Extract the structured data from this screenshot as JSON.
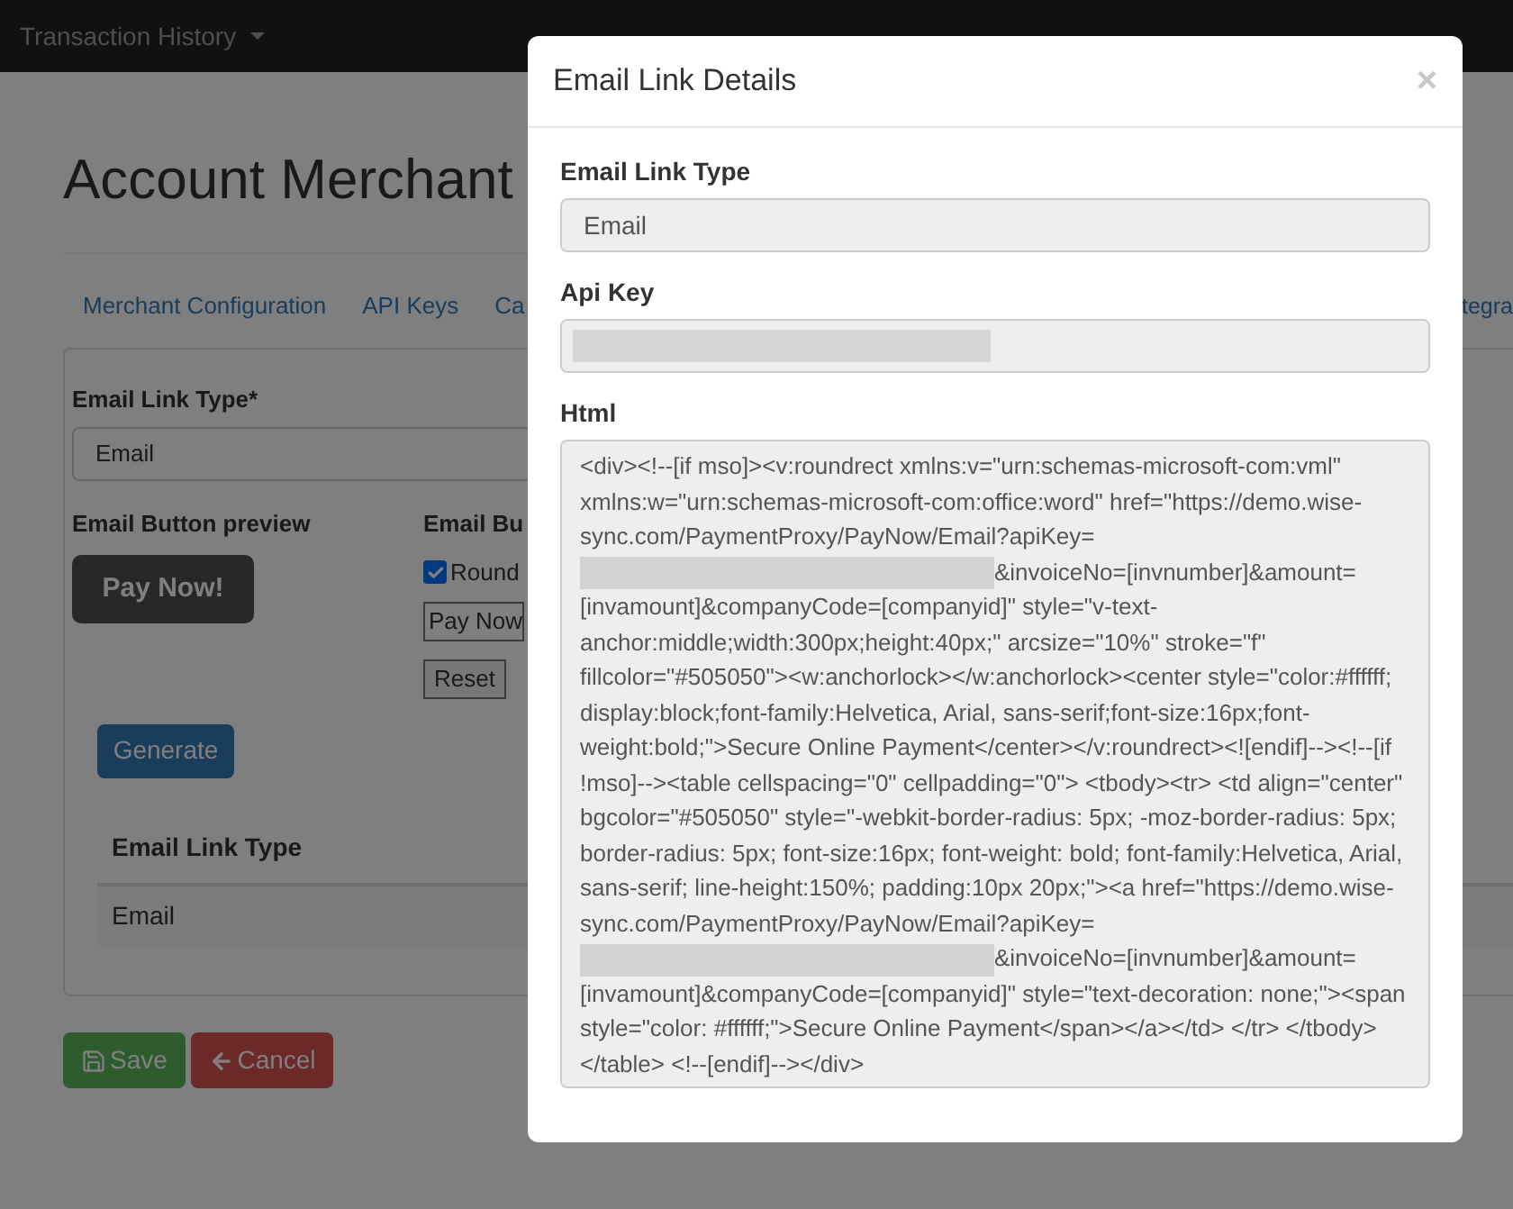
{
  "navbar": {
    "menu": "Transaction History"
  },
  "page": {
    "title": "Account Merchant",
    "tabs": [
      {
        "label": "Merchant Configuration"
      },
      {
        "label": "API Keys"
      },
      {
        "label": "Ca"
      },
      {
        "label": "tegra"
      }
    ],
    "form": {
      "email_link_type": {
        "label": "Email Link Type*",
        "value": "Email"
      },
      "preview": {
        "label": "Email Button preview",
        "button": "Pay Now!"
      },
      "options": {
        "label": "Email Bu",
        "checkbox": {
          "label": "Round",
          "checked": true
        },
        "text_value": "Pay Now",
        "reset": "Reset"
      },
      "generate": "Generate",
      "table": {
        "columns": [
          "Email Link Type"
        ],
        "rows": [
          [
            "Email"
          ]
        ]
      }
    },
    "actions": {
      "save": "Save",
      "cancel": "Cancel"
    }
  },
  "modal": {
    "title": "Email Link Details",
    "close": "×",
    "email_link_type": {
      "label": "Email Link Type",
      "value": "Email"
    },
    "api_key": {
      "label": "Api Key",
      "redacted": true
    },
    "html": {
      "label": "Html",
      "segments": [
        {
          "kind": "text",
          "text": "<div><!--[if mso]><v:roundrect xmlns:v=\"urn:schemas-microsoft-com:vml\" xmlns:w=\"urn:schemas-microsoft-com:office:word\" href=\"https://demo.wise-sync.com/PaymentProxy/PayNow/Email?apiKey="
        },
        {
          "kind": "redacted"
        },
        {
          "kind": "text",
          "text": "&invoiceNo=[invnumber]&amount=[invamount]&companyCode=[companyid]\" style=\"v-text-anchor:middle;width:300px;height:40px;\" arcsize=\"10%\" stroke=\"f\" fillcolor=\"#505050\"><w:anchorlock></w:anchorlock><center style=\"color:#ffffff; display:block;font-family:Helvetica, Arial, sans-serif;font-size:16px;font-weight:bold;\">Secure Online Payment</center></v:roundrect><![endif]--><!--[if !mso]--><table cellspacing=\"0\" cellpadding=\"0\"> <tbody><tr> <td align=\"center\" bgcolor=\"#505050\" style=\"-webkit-border-radius: 5px; -moz-border-radius: 5px; border-radius: 5px; font-size:16px; font-weight: bold; font-family:Helvetica, Arial, sans-serif; line-height:150%; padding:10px 20px;\"><a href=\"https://demo.wise-sync.com/PaymentProxy/PayNow/Email?apiKey="
        },
        {
          "kind": "redacted"
        },
        {
          "kind": "text",
          "text": "&invoiceNo=[invnumber]&amount=[invamount]&companyCode=[companyid]\" style=\"text-decoration: none;\"><span style=\"color: #ffffff;\">Secure Online Payment</span></a></td> </tr> </tbody></table> <!--[endif]--></div>"
        }
      ]
    }
  }
}
